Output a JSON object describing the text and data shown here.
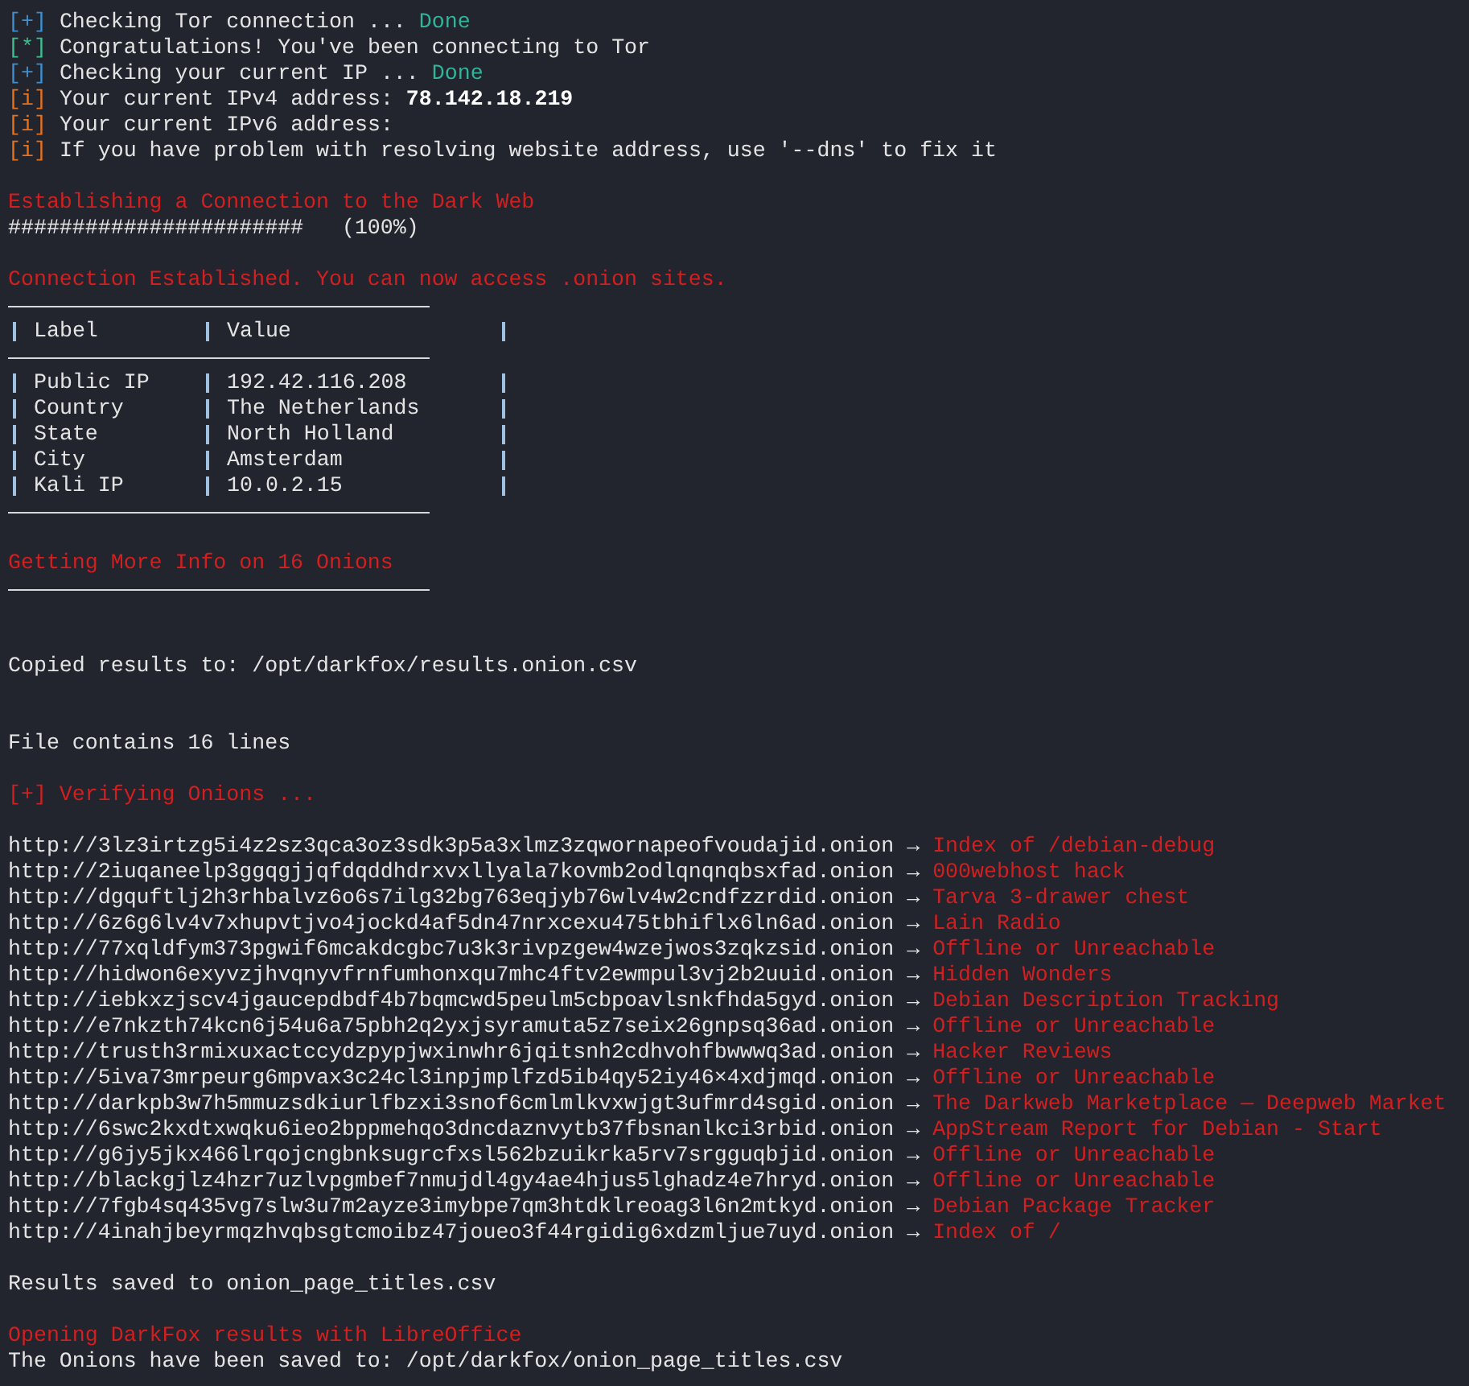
{
  "terminal": {
    "lines": [
      {
        "kind": "status",
        "marker": "[+]",
        "color": "#3d8fd1",
        "text": "Checking Tor connection ...",
        "result": "Done"
      },
      {
        "kind": "status",
        "marker": "[*]",
        "color": "#3fbf8f",
        "text": "Congratulations! You've been connecting to Tor"
      },
      {
        "kind": "status",
        "marker": "[+]",
        "color": "#3d8fd1",
        "text": "Checking your current IP ...",
        "result": "Done"
      },
      {
        "kind": "status",
        "marker": "[i]",
        "color": "#e8711c",
        "text": "Your current IPv4 address:",
        "value": "78.142.18.219"
      },
      {
        "kind": "status",
        "marker": "[i]",
        "color": "#e8711c",
        "text": "Your current IPv6 address:"
      },
      {
        "kind": "status",
        "marker": "[i]",
        "color": "#e8711c",
        "text": "If you have problem with resolving website address, use '--dns' to fix it"
      },
      {
        "kind": "blank"
      },
      {
        "kind": "alert",
        "text": "Establishing a Connection to the Dark Web"
      },
      {
        "kind": "plain",
        "text": "#######################   (100%)"
      },
      {
        "kind": "blank"
      },
      {
        "kind": "alert",
        "text": "Connection Established. You can now access .onion sites."
      },
      {
        "kind": "table",
        "columns": [
          "Label",
          "Value"
        ],
        "rows": [
          [
            "Public IP",
            "192.42.116.208"
          ],
          [
            "Country",
            "The Netherlands"
          ],
          [
            "State",
            "North Holland"
          ],
          [
            "City",
            "Amsterdam"
          ],
          [
            "Kali IP",
            "10.0.2.15"
          ]
        ]
      },
      {
        "kind": "blank"
      },
      {
        "kind": "alert",
        "text": "Getting More Info on 16 Onions"
      },
      {
        "kind": "rule"
      },
      {
        "kind": "blank"
      },
      {
        "kind": "blank"
      },
      {
        "kind": "plain",
        "text": "Copied results to: /opt/darkfox/results.onion.csv"
      },
      {
        "kind": "blank"
      },
      {
        "kind": "blank"
      },
      {
        "kind": "plain",
        "text": "File contains 16 lines"
      },
      {
        "kind": "blank"
      },
      {
        "kind": "alert",
        "text": "[+] Verifying Onions ..."
      },
      {
        "kind": "blank"
      },
      {
        "kind": "onions",
        "items": [
          {
            "url": "http://3lz3irtzg5i4z2sz3qca3oz3sdk3p5a3xlmz3zqwornapeofvoudajid.onion",
            "arrow": "→",
            "title": "Index of /debian-debug"
          },
          {
            "url": "http://2iuqaneelp3ggqgjjqfdqddhdrxvxllyala7kovmb2odlqnqnqbsxfad.onion",
            "arrow": "→",
            "title": "000webhost hack"
          },
          {
            "url": "http://dgquftlj2h3rhbalvz6o6s7ilg32bg763eqjyb76wlv4w2cndfzzrdid.onion",
            "arrow": "→",
            "title": "Tarva 3-drawer chest"
          },
          {
            "url": "http://6z6g6lv4v7xhupvtjvo4jockd4af5dn47nrxcexu475tbhiflx6ln6ad.onion",
            "arrow": "→",
            "title": "Lain Radio"
          },
          {
            "url": "http://77xqldfym373pgwif6mcakdcgbc7u3k3rivpzgew4wzejwos3zqkzsid.onion",
            "arrow": "→",
            "title": "Offline or Unreachable"
          },
          {
            "url": "http://hidwon6exyvzjhvqnyvfrnfumhonxqu7mhc4ftv2ewmpul3vj2b2uuid.onion",
            "arrow": "→",
            "title": "Hidden Wonders"
          },
          {
            "url": "http://iebkxzjscv4jgaucepdbdf4b7bqmcwd5peulm5cbpoavlsnkfhda5gyd.onion",
            "arrow": "→",
            "title": "Debian Description Tracking"
          },
          {
            "url": "http://e7nkzth74kcn6j54u6a75pbh2q2yxjsyramuta5z7seix26gnpsq36ad.onion",
            "arrow": "→",
            "title": "Offline or Unreachable"
          },
          {
            "url": "http://trusth3rmixuxactccydzpypjwxinwhr6jqitsnh2cdhvohfbwwwq3ad.onion",
            "arrow": "→",
            "title": "Hacker Reviews"
          },
          {
            "url": "http://5iva73mrpeurg6mpvax3c24cl3inpjmplfzd5ib4qy52iy46×4xdjmqd.onion",
            "arrow": "→",
            "title": "Offline or Unreachable"
          },
          {
            "url": "http://darkpb3w7h5mmuzsdkiurlfbzxi3snof6cmlmlkvxwjgt3ufmrd4sgid.onion",
            "arrow": "→",
            "title": "The Darkweb Marketplace — Deepweb Market"
          },
          {
            "url": "http://6swc2kxdtxwqku6ieo2bppmehqo3dncdaznvytb37fbsnanlkci3rbid.onion",
            "arrow": "→",
            "title": "AppStream Report for Debian - Start"
          },
          {
            "url": "http://g6jy5jkx466lrqojcngbnksugrcfxsl562bzuikrka5rv7srgguqbjid.onion",
            "arrow": "→",
            "title": "Offline or Unreachable"
          },
          {
            "url": "http://blackgjlz4hzr7uzlvpgmbef7nmujdl4gy4ae4hjus5lghadz4e7hryd.onion",
            "arrow": "→",
            "title": "Offline or Unreachable"
          },
          {
            "url": "http://7fgb4sq435vg7slw3u7m2ayze3imybpe7qm3htdklreoag3l6n2mtkyd.onion",
            "arrow": "→",
            "title": "Debian Package Tracker"
          },
          {
            "url": "http://4inahjbeyrmqzhvqbsgtcmoibz47joueo3f44rgidig6xdzmljue7uyd.onion",
            "arrow": "→",
            "title": "Index of /"
          }
        ]
      },
      {
        "kind": "blank"
      },
      {
        "kind": "plain",
        "text": "Results saved to onion_page_titles.csv"
      },
      {
        "kind": "blank"
      },
      {
        "kind": "alert",
        "text": "Opening DarkFox results with LibreOffice"
      },
      {
        "kind": "plain",
        "text": "The Onions have been saved to: /opt/darkfox/onion_page_titles.csv"
      }
    ]
  }
}
